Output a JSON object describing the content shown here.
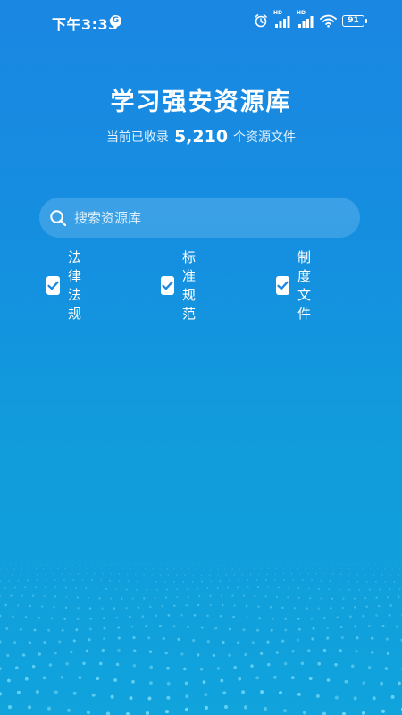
{
  "status_bar": {
    "time": "下午3:33",
    "app_icon_glyph": "G",
    "signal_label_1": "HD",
    "signal_label_2": "HD",
    "battery": "91"
  },
  "header": {
    "title": "学习强安资源库",
    "subtitle_prefix": "当前已收录",
    "count": "5,210",
    "subtitle_suffix": "个资源文件"
  },
  "search": {
    "placeholder": "搜索资源库",
    "value": ""
  },
  "filters": [
    {
      "label": "法律法规",
      "checked": true
    },
    {
      "label": "标准规范",
      "checked": true
    },
    {
      "label": "制度文件",
      "checked": true
    }
  ],
  "colors": {
    "background_top": "#1a87e2",
    "background_bottom": "#10a3dc",
    "text": "#ffffff",
    "checkmark": "#1a87e2"
  }
}
